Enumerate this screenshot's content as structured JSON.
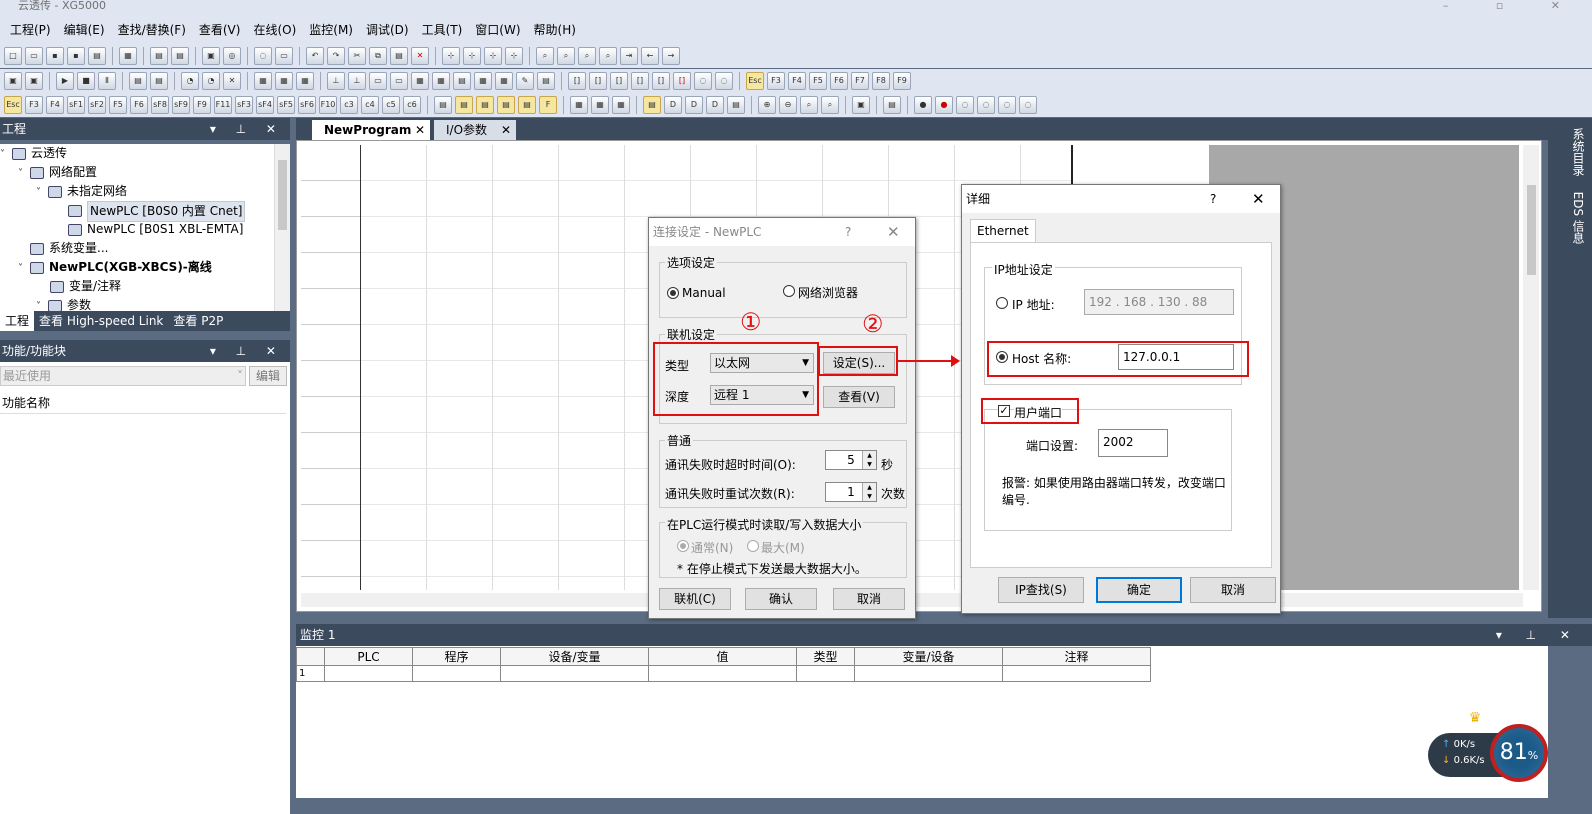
{
  "window": {
    "title": "云透传 - XG5000"
  },
  "menu": [
    "工程(P)",
    "编辑(E)",
    "查找/替换(F)",
    "查看(V)",
    "在线(O)",
    "监控(M)",
    "调试(D)",
    "工具(T)",
    "窗口(W)",
    "帮助(H)"
  ],
  "toolbar3_labels": [
    "Esc",
    "F3",
    "F4",
    "sF1",
    "sF2",
    "F5",
    "F6",
    "sF8",
    "sF9",
    "F9",
    "F11",
    "sF3",
    "sF4",
    "sF5",
    "sF6",
    "F10",
    "c3",
    "c4",
    "c5",
    "c6"
  ],
  "toolbar2_labels": [
    "Esc",
    "F3",
    "F4",
    "F5",
    "F6",
    "F7",
    "F8",
    "F9"
  ],
  "project_panel": {
    "title": "工程",
    "tree": [
      {
        "label": "云透传"
      },
      {
        "label": "网络配置"
      },
      {
        "label": "未指定网络"
      },
      {
        "label": "NewPLC [B0S0 内置 Cnet]"
      },
      {
        "label": "NewPLC [B0S1 XBL-EMTA]"
      },
      {
        "label": "系统变量..."
      },
      {
        "label": "NewPLC(XGB-XBCS)-离线"
      },
      {
        "label": "变量/注释"
      },
      {
        "label": "参数"
      }
    ],
    "tabs": [
      "工程",
      "查看 High-speed Link",
      "查看 P2P"
    ]
  },
  "function_panel": {
    "title": "功能/功能块",
    "filter": "最近使用",
    "edit_button": "编辑",
    "column": "功能名称"
  },
  "doc_tabs": [
    "NewProgram",
    "I/O参数"
  ],
  "side_labels": {
    "a": "系统目录",
    "b": "EDS 信息"
  },
  "monitor": {
    "title": "监控 1",
    "columns": [
      "PLC",
      "程序",
      "设备/变量",
      "值",
      "类型",
      "变量/设备",
      "注释"
    ],
    "row_index": "1"
  },
  "conn_dialog": {
    "title": "连接设定 - NewPLC",
    "help": "?",
    "options_group": "选项设定",
    "manual": "Manual",
    "network_browser": "网络浏览器",
    "conn_group": "联机设定",
    "type_label": "类型",
    "type_value": "以太网",
    "depth_label": "深度",
    "depth_value": "远程 1",
    "settings_button": "设定(S)...",
    "view_button": "查看(V)",
    "general_group": "普通",
    "timeout_label": "通讯失败时超时时间(O):",
    "timeout_value": "5",
    "timeout_unit": "秒",
    "retry_label": "通讯失败时重试次数(R):",
    "retry_value": "1",
    "retry_unit": "次数",
    "size_group": "在PLC运行模式时读取/写入数据大小",
    "normal": "通常(N)",
    "max": "最大(M)",
    "note": "* 在停止模式下发送最大数据大小。",
    "connect_button": "联机(C)",
    "ok_button": "确认",
    "cancel_button": "取消"
  },
  "annotations": {
    "one": "①",
    "two": "②"
  },
  "detail_dialog": {
    "title": "详细",
    "help": "?",
    "tab": "Ethernet",
    "ip_group": "IP地址设定",
    "ip_label": "IP 地址:",
    "ip_value": "192 . 168 . 130 . 88",
    "host_label": "Host 名称:",
    "host_value": "127.0.0.1",
    "user_port_label": "用户端口",
    "port_label": "端口设置:",
    "port_value": "2002",
    "warning": "报警: 如果使用路由器端口转发，改变端口编号.",
    "ip_find_button": "IP查找(S)",
    "ok_button": "确定",
    "cancel_button": "取消"
  },
  "net_widget": {
    "up": "0K/s",
    "down": "0.6K/s",
    "percent": "81",
    "pct_sign": "%"
  }
}
